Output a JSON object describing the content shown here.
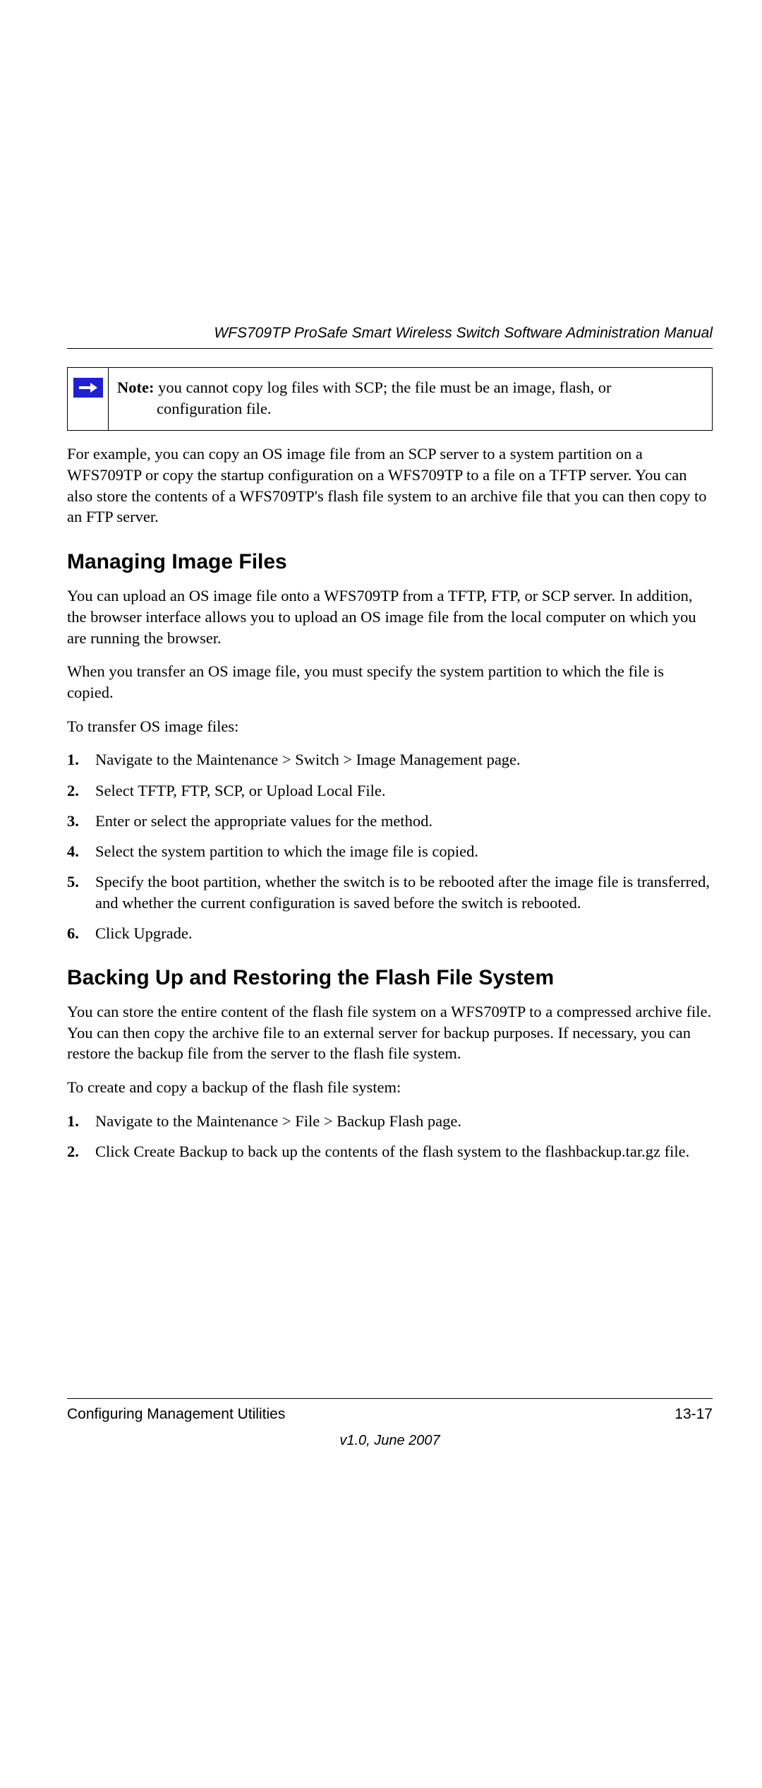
{
  "header": {
    "title": "WFS709TP ProSafe Smart Wireless Switch Software Administration Manual"
  },
  "note": {
    "label": "Note:",
    "text_part1": " you cannot copy log files with SCP; the file must be an image, flash, or",
    "text_part2": "configuration file."
  },
  "para_intro": "For example, you can copy an OS image file from an SCP server to a system partition on a WFS709TP or copy the startup configuration on a WFS709TP to a file on a TFTP server. You can also store the contents of a WFS709TP's flash file system to an archive file that you can then copy to an FTP server.",
  "section1": {
    "heading": "Managing Image Files",
    "p1": "You can upload an OS image file onto a WFS709TP from a TFTP, FTP, or SCP server. In addition, the browser interface allows you to upload an OS image file from the local computer on which you are running the browser.",
    "p2": "When you transfer an OS image file, you must specify the system partition to which the file is copied.",
    "p3": "To transfer OS image files:",
    "steps": [
      "Navigate to the Maintenance > Switch > Image Management page.",
      "Select TFTP, FTP, SCP, or Upload Local File.",
      "Enter or select the appropriate values for the method.",
      "Select the system partition to which the image file is copied.",
      "Specify the boot partition, whether the switch is to be rebooted after the image file is transferred, and whether the current configuration is saved before the switch is rebooted.",
      "Click Upgrade."
    ]
  },
  "section2": {
    "heading": "Backing Up and Restoring the Flash File System",
    "p1": "You can store the entire content of the flash file system on a WFS709TP to a compressed archive file. You can then copy the archive file to an external server for backup purposes. If necessary, you can restore the backup file from the server to the flash file system.",
    "p2": "To create and copy a backup of the flash file system:",
    "steps": [
      "Navigate to the Maintenance > File > Backup Flash page.",
      "Click Create Backup to back up the contents of the flash system to the flashbackup.tar.gz file."
    ]
  },
  "footer": {
    "chapter": "Configuring Management Utilities",
    "pagenum": "13-17",
    "version": "v1.0, June 2007"
  }
}
